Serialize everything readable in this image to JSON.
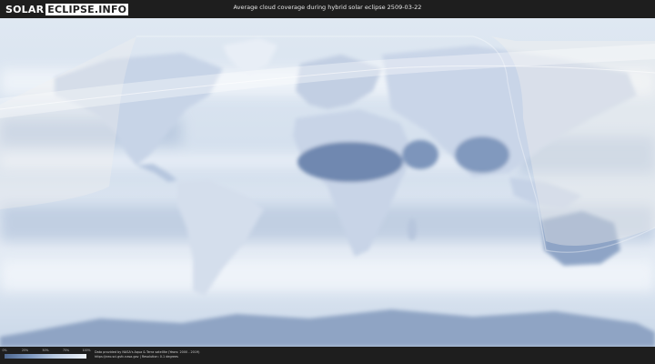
{
  "logo": {
    "part1": "SOLAR",
    "part2": "ECLIPSE.INFO"
  },
  "title": "Average cloud coverage during hybrid solar eclipse 2509-03-22",
  "legend": {
    "ticks": [
      "0%",
      "25%",
      "50%",
      "75%",
      "100%"
    ],
    "colors": {
      "low": "#4f688f",
      "mid": "#b8c9e0",
      "high": "#eef2f8"
    }
  },
  "credits": {
    "line1": "Data provided by NASA's Aqua & Terra satellite (Years: 2000 - 2019)",
    "line2": "https://neo.sci.gsfc.nasa.gov | Resolution: 0.1 degrees"
  },
  "map": {
    "ocean_color": "#d7e2ef",
    "land_color": "#eaf0f7",
    "clear_sky_color": "#6d86ae",
    "penumbra_color": "#f3f1ec"
  }
}
